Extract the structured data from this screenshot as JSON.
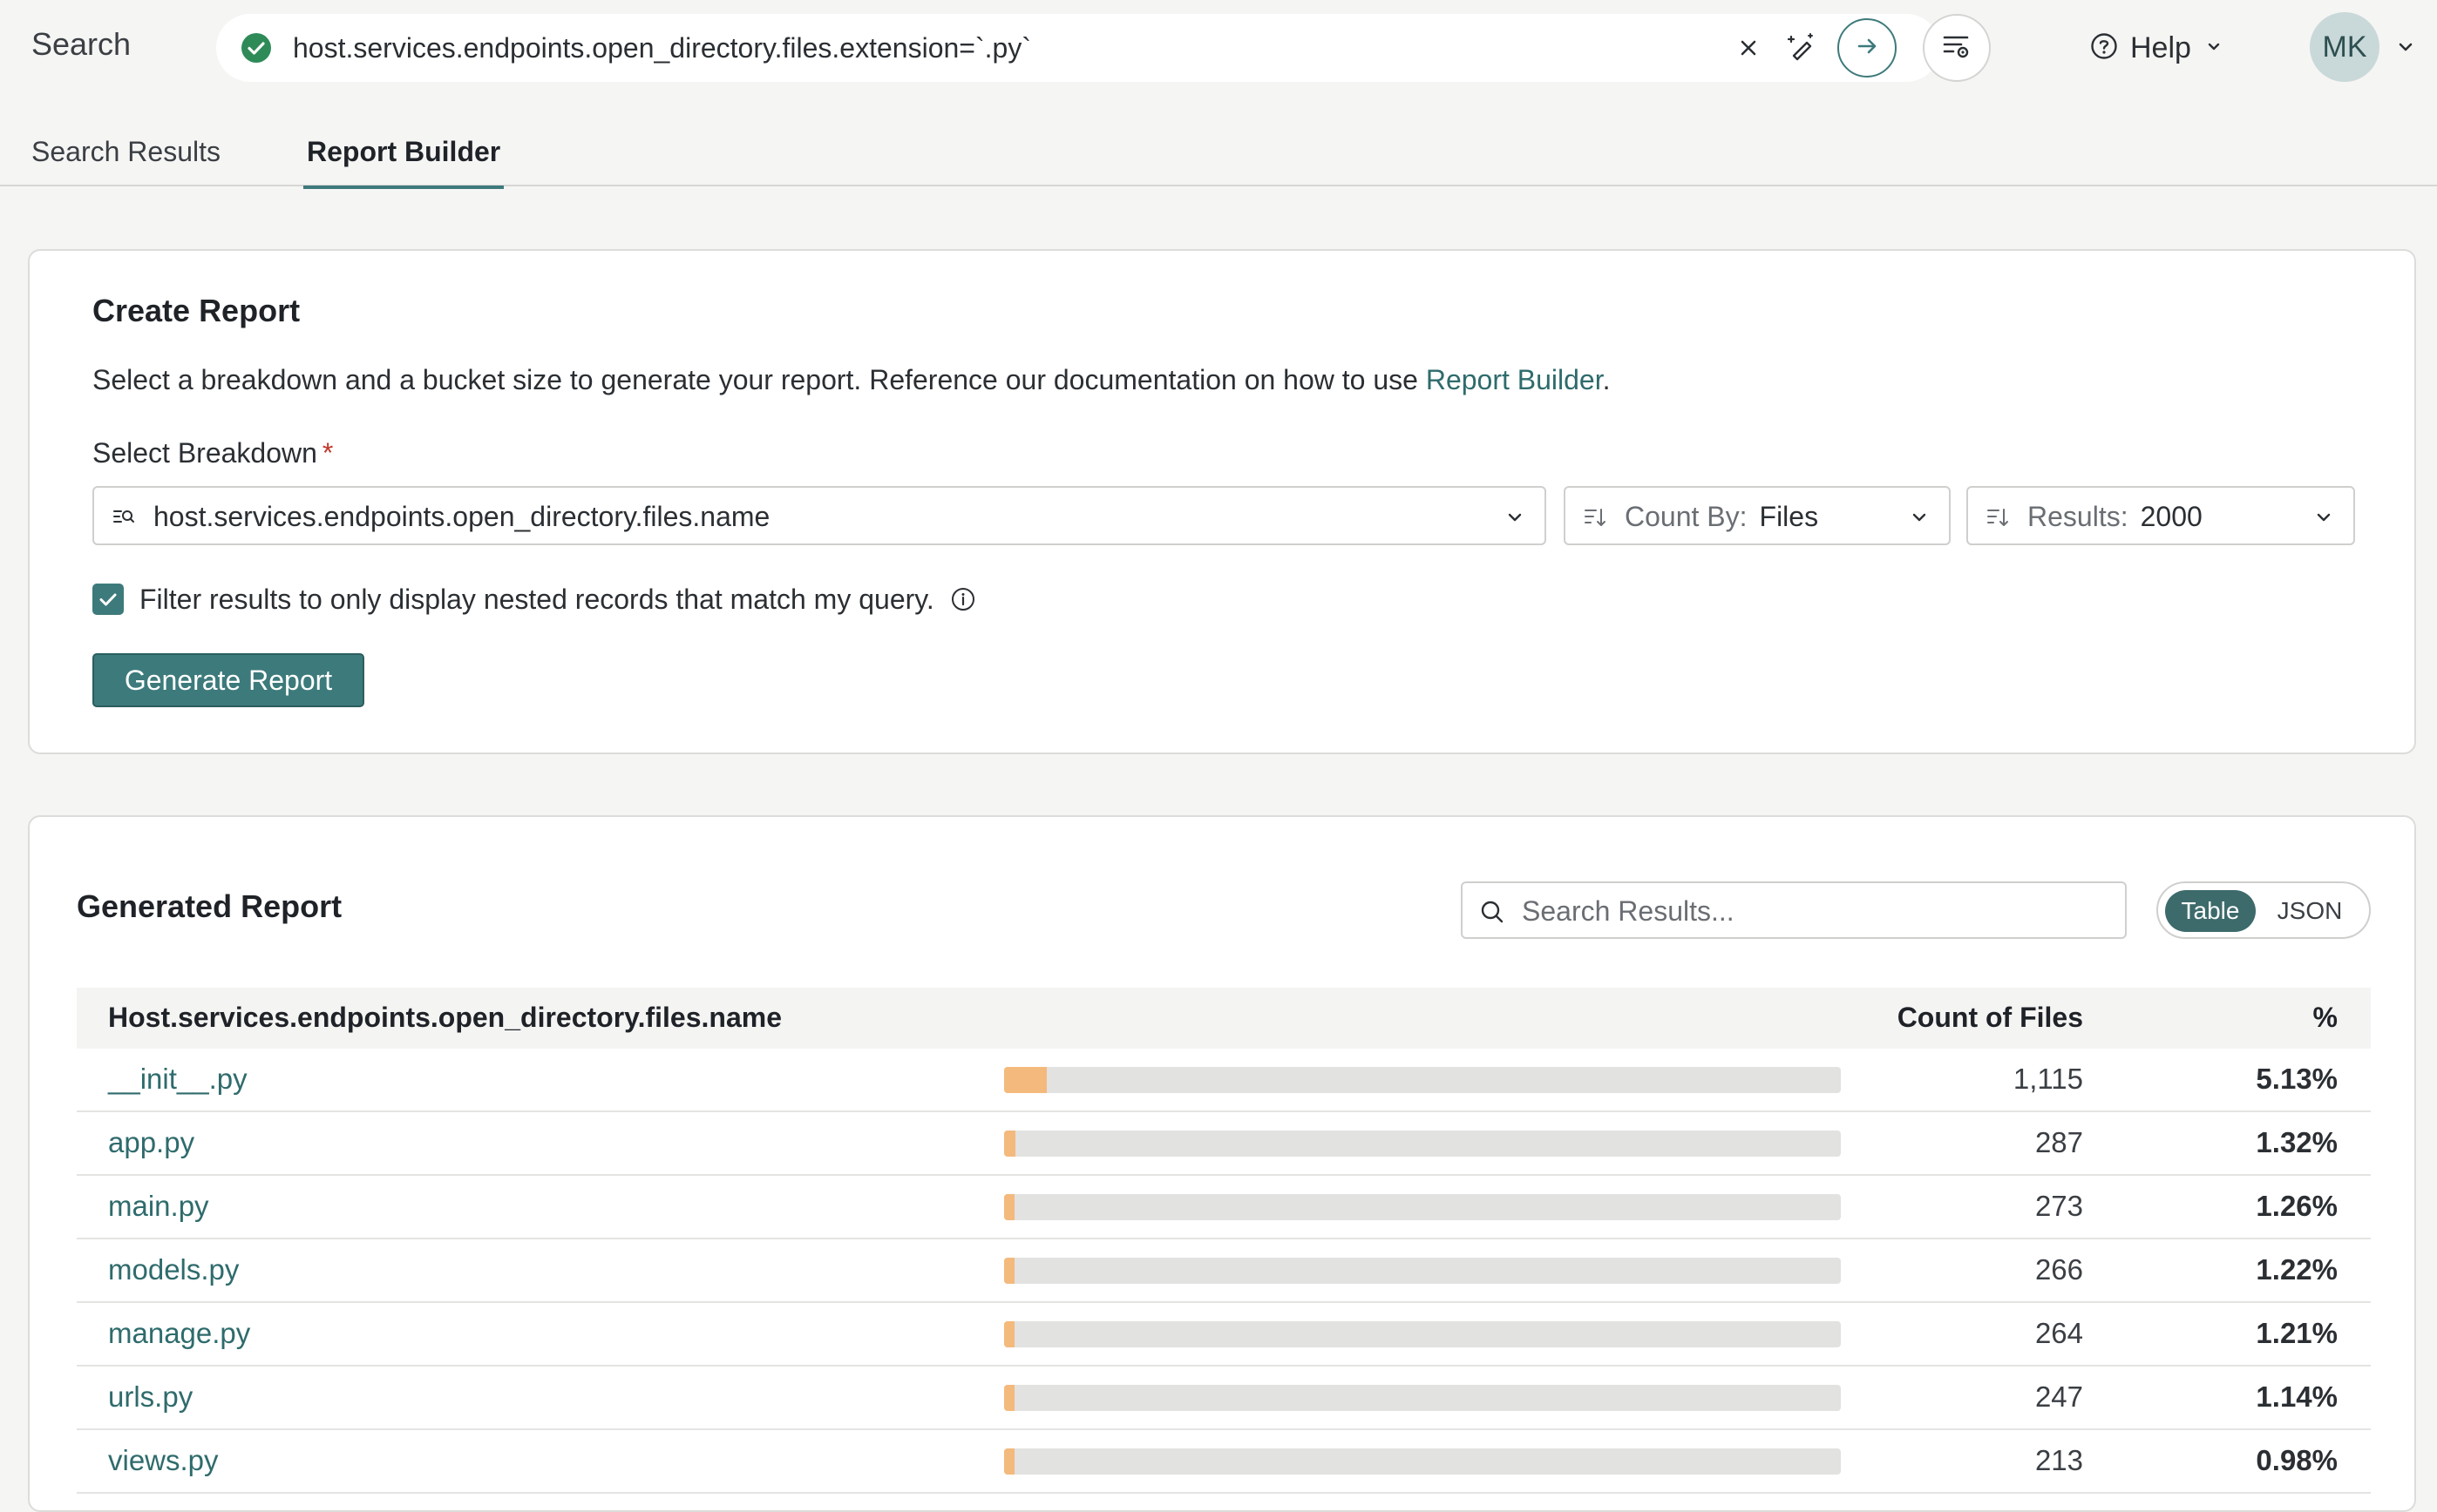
{
  "header": {
    "app_title": "Search",
    "query": "host.services.endpoints.open_directory.files.extension=`.py`",
    "help_label": "Help",
    "avatar_initials": "MK"
  },
  "tabs": [
    {
      "label": "Search Results",
      "active": false
    },
    {
      "label": "Report Builder",
      "active": true
    }
  ],
  "create_report": {
    "title": "Create Report",
    "description_prefix": "Select a breakdown and a bucket size to generate your report. Reference our documentation on how to use ",
    "description_link": "Report Builder",
    "description_suffix": ".",
    "breakdown_label": "Select Breakdown",
    "required_mark": "*",
    "breakdown_value": "host.services.endpoints.open_directory.files.name",
    "count_by_prefix": "Count By:",
    "count_by_value": "Files",
    "results_prefix": "Results:",
    "results_value": "2000",
    "filter_checked": true,
    "filter_label": "Filter results to only display nested records that match my query.",
    "generate_button": "Generate Report"
  },
  "generated_report": {
    "title": "Generated Report",
    "search_placeholder": "Search Results...",
    "view_options": [
      "Table",
      "JSON"
    ],
    "active_view": "Table",
    "columns": {
      "name": "Host.services.endpoints.open_directory.files.name",
      "count": "Count of Files",
      "percent": "%"
    },
    "rows": [
      {
        "name": "__init__.py",
        "count": "1,115",
        "percent": "5.13%",
        "share": 0.0513
      },
      {
        "name": "app.py",
        "count": "287",
        "percent": "1.32%",
        "share": 0.0132
      },
      {
        "name": "main.py",
        "count": "273",
        "percent": "1.26%",
        "share": 0.0126
      },
      {
        "name": "models.py",
        "count": "266",
        "percent": "1.22%",
        "share": 0.0122
      },
      {
        "name": "manage.py",
        "count": "264",
        "percent": "1.21%",
        "share": 0.0121
      },
      {
        "name": "urls.py",
        "count": "247",
        "percent": "1.14%",
        "share": 0.0114
      },
      {
        "name": "views.py",
        "count": "213",
        "percent": "0.98%",
        "share": 0.0098
      }
    ]
  },
  "colors": {
    "accent": "#3d7a7b",
    "bar_fill": "#f4b97c",
    "bar_track": "#e2e2e1",
    "success": "#2e8b57"
  },
  "icons": {
    "status": "check-circle-icon",
    "clear": "close-icon",
    "magic": "wand-icon",
    "submit": "arrow-right-icon",
    "settings": "filter-settings-icon",
    "help": "question-circle-icon",
    "search": "search-icon",
    "info": "info-icon"
  }
}
